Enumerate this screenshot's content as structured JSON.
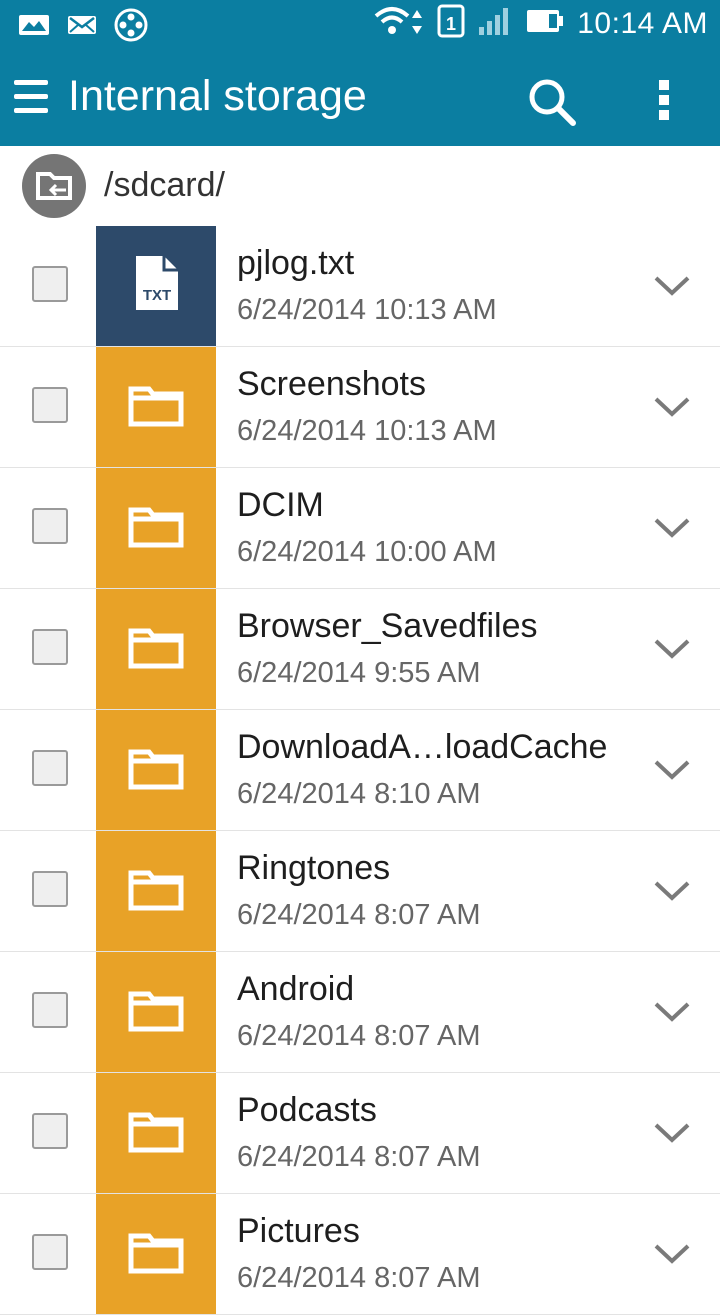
{
  "status_bar": {
    "time": "10:14 AM",
    "sim_slot": "1",
    "left_icons": [
      "gallery-notification-icon",
      "email-notification-icon",
      "media-reel-icon"
    ],
    "right_icons": [
      "wifi-icon",
      "sim-icon",
      "signal-icon",
      "battery-icon"
    ]
  },
  "app_bar": {
    "title": "Internal storage",
    "background_color": "#0b7ea1"
  },
  "path_bar": {
    "path": "/sdcard/"
  },
  "colors": {
    "folder": "#e8a227",
    "text_file": "#2d4a6a"
  },
  "files": [
    {
      "name": "pjlog.txt",
      "date": "6/24/2014 10:13 AM",
      "type": "txt",
      "badge": "TXT"
    },
    {
      "name": "Screenshots",
      "date": "6/24/2014 10:13 AM",
      "type": "folder"
    },
    {
      "name": "DCIM",
      "date": "6/24/2014 10:00 AM",
      "type": "folder"
    },
    {
      "name": "Browser_Savedfiles",
      "date": "6/24/2014 9:55 AM",
      "type": "folder"
    },
    {
      "name": "DownloadA…loadCache",
      "date": "6/24/2014 8:10 AM",
      "type": "folder"
    },
    {
      "name": "Ringtones",
      "date": "6/24/2014 8:07 AM",
      "type": "folder"
    },
    {
      "name": "Android",
      "date": "6/24/2014 8:07 AM",
      "type": "folder"
    },
    {
      "name": "Podcasts",
      "date": "6/24/2014 8:07 AM",
      "type": "folder"
    },
    {
      "name": "Pictures",
      "date": "6/24/2014 8:07 AM",
      "type": "folder"
    }
  ]
}
